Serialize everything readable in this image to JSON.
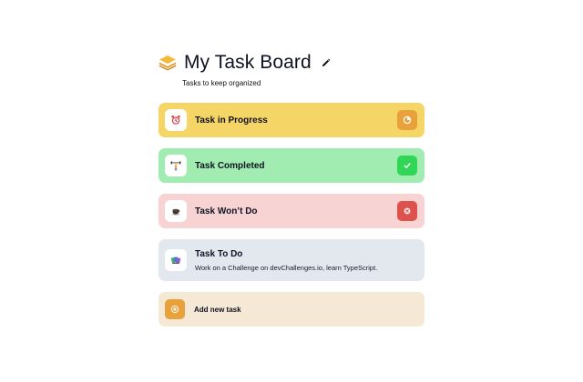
{
  "board": {
    "title": "My Task Board",
    "subtitle": "Tasks to keep organized",
    "logo_icon": "stacked-layers-icon",
    "edit_icon": "pencil-icon"
  },
  "tasks": [
    {
      "title": "Task in Progress",
      "description": "",
      "emoji_icon": "alarm-clock-icon",
      "status": "in-progress",
      "status_icon": "hourglass-icon",
      "color": "#f5d565"
    },
    {
      "title": "Task Completed",
      "description": "",
      "emoji_icon": "weightlifter-icon",
      "status": "completed",
      "status_icon": "check-icon",
      "color": "#a0ecb1"
    },
    {
      "title": "Task Won’t Do",
      "description": "",
      "emoji_icon": "coffee-cup-icon",
      "status": "wont-do",
      "status_icon": "close-icon",
      "color": "#f7d4d3"
    },
    {
      "title": "Task To Do",
      "description": "Work on a Challenge on devChallenges.io, learn TypeScript.",
      "emoji_icon": "books-icon",
      "status": "to-do",
      "color": "#e3e8ef"
    }
  ],
  "add_task": {
    "label": "Add new task",
    "icon": "plus-icon",
    "color": "#f5e8d5"
  }
}
